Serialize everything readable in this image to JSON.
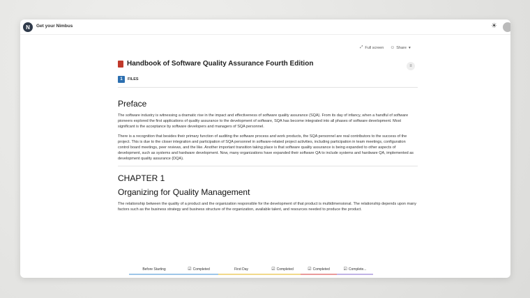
{
  "app": {
    "title": "Get your Nimbus",
    "logo_letter": "N"
  },
  "toolbar": {
    "fullscreen_label": "Full screen",
    "share_label": "Share"
  },
  "document": {
    "title": "Handbook of Software Quality Assurance Fourth Edition",
    "files_count": "1",
    "files_label": "FILES",
    "preface_heading": "Preface",
    "preface_para_1": "The software industry is witnessing a dramatic rise in the impact and effectiveness of software quality assurance (SQA). From its day of infancy, when a handful of software pioneers explored the first applications of quality assurance to the development of software, SQA has become integrated into all phases of software development. Most significant is the acceptance by software developers and managers of SQA personnel.",
    "preface_para_2": "There is a recognition that besides their primary function of auditing the software process and work products, the SQA personnel are real contributors to the success of the project. This is due to the closer integration and participation of SQA personnel in software-related project activities, including participation in team meetings, configuration control board meetings, peer reviews, and the like. Another important transition taking place is that software quality assurance is being expanded to other aspects of development, such as systems and hardware development. Now, many organizations have expanded their software QA to include systems and hardware QA, implemented as development quality assurance (DQA).",
    "chapter_label": "CHAPTER 1",
    "chapter_title": "Organizing for Quality Management",
    "chapter_para": "The relationship between the quality of a product and the organization responsible for the development of that product is multidimensional. The relationship depends upon many factors such as the business strategy and business structure of the organization, available talent, and resources needed to produce the product."
  },
  "progress": [
    {
      "label": "Before Starting",
      "color": "#9ec6e8"
    },
    {
      "label": "Completed",
      "color": "#9ec6e8",
      "checked": true
    },
    {
      "label": "First Day",
      "color": "#f1d98a"
    },
    {
      "label": "Completed",
      "color": "#f1d98a",
      "checked": true
    },
    {
      "label": "Completed",
      "color": "#e99a9a",
      "checked": true
    },
    {
      "label": "Complete...",
      "color": "#c2b4e6",
      "checked": true
    }
  ],
  "colors": {
    "accent": "#2c6fb0",
    "book": "#c0392b"
  }
}
